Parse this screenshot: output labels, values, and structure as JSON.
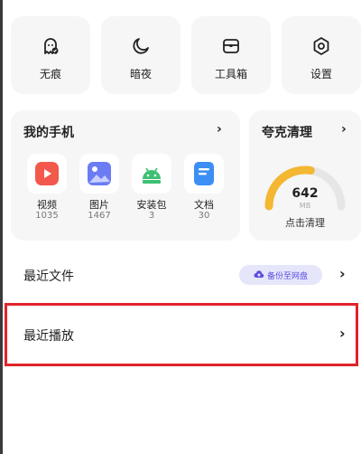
{
  "quick_actions": [
    {
      "label": "无痕",
      "icon": "ghost-icon"
    },
    {
      "label": "暗夜",
      "icon": "moon-icon"
    },
    {
      "label": "工具箱",
      "icon": "toolbox-icon"
    },
    {
      "label": "设置",
      "icon": "gear-icon"
    }
  ],
  "my_phone": {
    "title": "我的手机",
    "apps": [
      {
        "label": "视频",
        "count": "1035",
        "icon": "video-icon",
        "color": "#f2584c"
      },
      {
        "label": "图片",
        "count": "1467",
        "icon": "image-icon",
        "color": "#6b7cf5"
      },
      {
        "label": "安装包",
        "count": "3",
        "icon": "android-icon",
        "color": "#3fbf73"
      },
      {
        "label": "文档",
        "count": "30",
        "icon": "document-icon",
        "color": "#3d8ef5"
      }
    ]
  },
  "cleaner": {
    "title": "夸克清理",
    "value": "642",
    "unit": "MB",
    "action": "点击清理",
    "gauge_fraction": 0.55,
    "accent": "#f3b731"
  },
  "recent_files": {
    "title": "最近文件",
    "backup_label": "备份至网盘"
  },
  "recent_play": {
    "title": "最近播放"
  }
}
